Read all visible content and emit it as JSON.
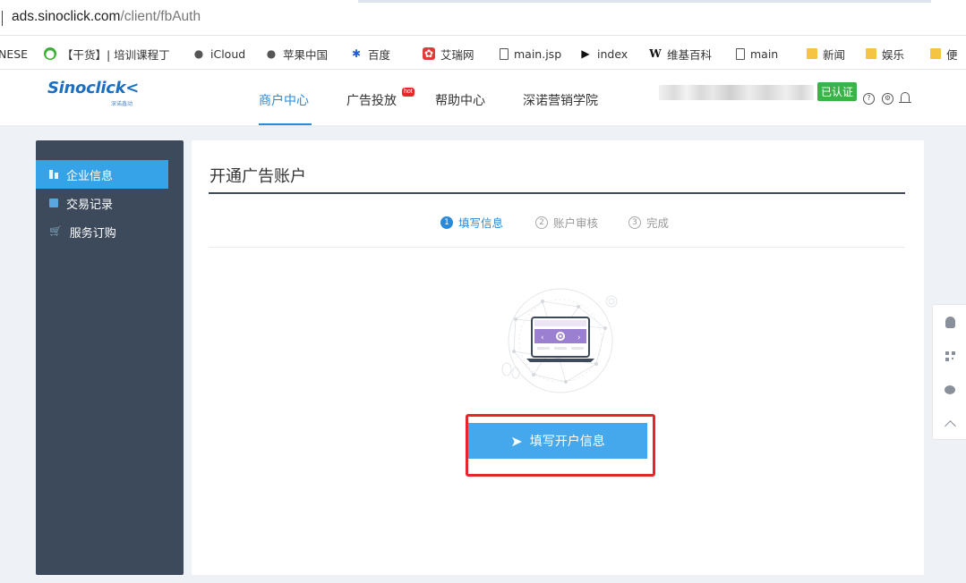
{
  "address_bar": {
    "url_host": "ads.sinoclick.com",
    "url_path": "/client/fbAuth"
  },
  "bookmarks": [
    {
      "label": "NESE",
      "icon": "none"
    },
    {
      "label": "【干货】| 培训课程丁",
      "icon": "wechat-icon"
    },
    {
      "label": "iCloud",
      "icon": "apple-icon"
    },
    {
      "label": "苹果中国",
      "icon": "apple-icon"
    },
    {
      "label": "百度",
      "icon": "baidu-paw-icon"
    },
    {
      "label": "艾瑞网",
      "icon": "iresearch-icon"
    },
    {
      "label": "main.jsp",
      "icon": "document-icon"
    },
    {
      "label": "index",
      "icon": "visual-studio-icon"
    },
    {
      "label": "维基百科",
      "icon": "wikipedia-icon"
    },
    {
      "label": "main",
      "icon": "document-icon"
    },
    {
      "label": "新闻",
      "icon": "folder-icon"
    },
    {
      "label": "娱乐",
      "icon": "folder-icon"
    },
    {
      "label": "便",
      "icon": "folder-icon"
    }
  ],
  "header": {
    "logo_text": "Sinoclick",
    "logo_subtext": "深诺鑫动",
    "nav": [
      {
        "label": "商户中心",
        "active": true
      },
      {
        "label": "广告投放",
        "badge": "hot"
      },
      {
        "label": "帮助中心"
      },
      {
        "label": "深诺营销学院"
      }
    ],
    "verified_badge": "已认证",
    "colors": {
      "accent": "#2a8ad7",
      "verified": "#3bb34a",
      "hot": "#e82828"
    }
  },
  "sidebar": {
    "items": [
      {
        "label": "企业信息",
        "icon": "building-icon",
        "active": true
      },
      {
        "label": "交易记录",
        "icon": "document-icon"
      },
      {
        "label": "服务订购",
        "icon": "cart-icon"
      }
    ],
    "colors": {
      "bg": "#3d4a5c",
      "active": "#36a2e8"
    }
  },
  "main": {
    "title": "开通广告账户",
    "steps": [
      {
        "num": "1",
        "label": "填写信息",
        "active": true
      },
      {
        "num": "2",
        "label": "账户审核"
      },
      {
        "num": "3",
        "label": "完成"
      }
    ],
    "cta_label": "填写开户信息",
    "cta_color": "#45a8ec",
    "highlight_color": "#e8252b"
  },
  "float_toolbar": [
    "qq-icon",
    "qr-code-icon",
    "chat-icon",
    "chevron-up-icon"
  ]
}
